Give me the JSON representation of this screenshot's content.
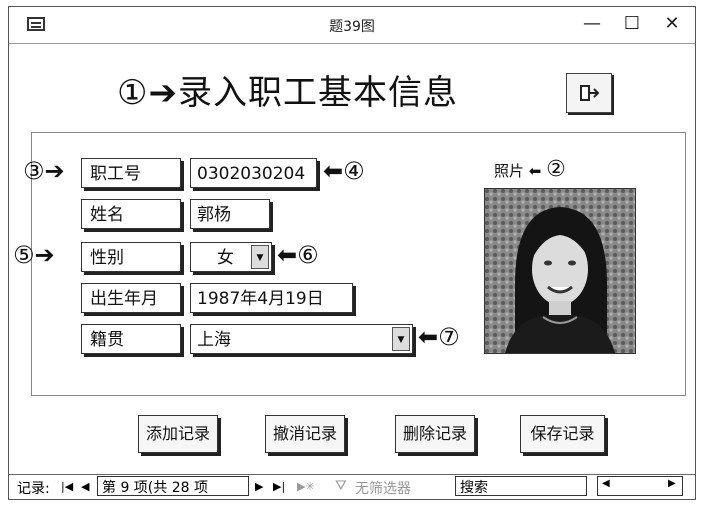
{
  "window": {
    "title": "题39图",
    "minimize": "—",
    "maximize": "☐",
    "close": "✕"
  },
  "heading": {
    "marker": "①",
    "text": "录入职工基本信息"
  },
  "fields": [
    {
      "label": "职工号",
      "value": "0302030204",
      "label_marker": "③",
      "field_marker": "④"
    },
    {
      "label": "姓名",
      "value": "郭杨"
    },
    {
      "label": "性别",
      "value": "女",
      "label_marker": "⑤",
      "field_marker": "⑥"
    },
    {
      "label": "出生年月",
      "value": "1987年4月19日"
    },
    {
      "label": "籍贯",
      "value": "上海",
      "field_marker": "⑦"
    }
  ],
  "photo": {
    "label": "照片",
    "marker": "②"
  },
  "buttons": {
    "add": "添加记录",
    "undo": "撤消记录",
    "delete": "删除记录",
    "save": "保存记录"
  },
  "navbar": {
    "record_label": "记录:",
    "record_position": "第 9 项(共 28 项",
    "filter": "无筛选器",
    "search": "搜索"
  },
  "icons": [
    "window-menu-icon",
    "exit-door-icon",
    "dropdown-arrow-icon",
    "first-record-icon",
    "prev-record-icon",
    "next-record-icon",
    "last-record-icon",
    "new-record-icon",
    "filter-icon"
  ]
}
